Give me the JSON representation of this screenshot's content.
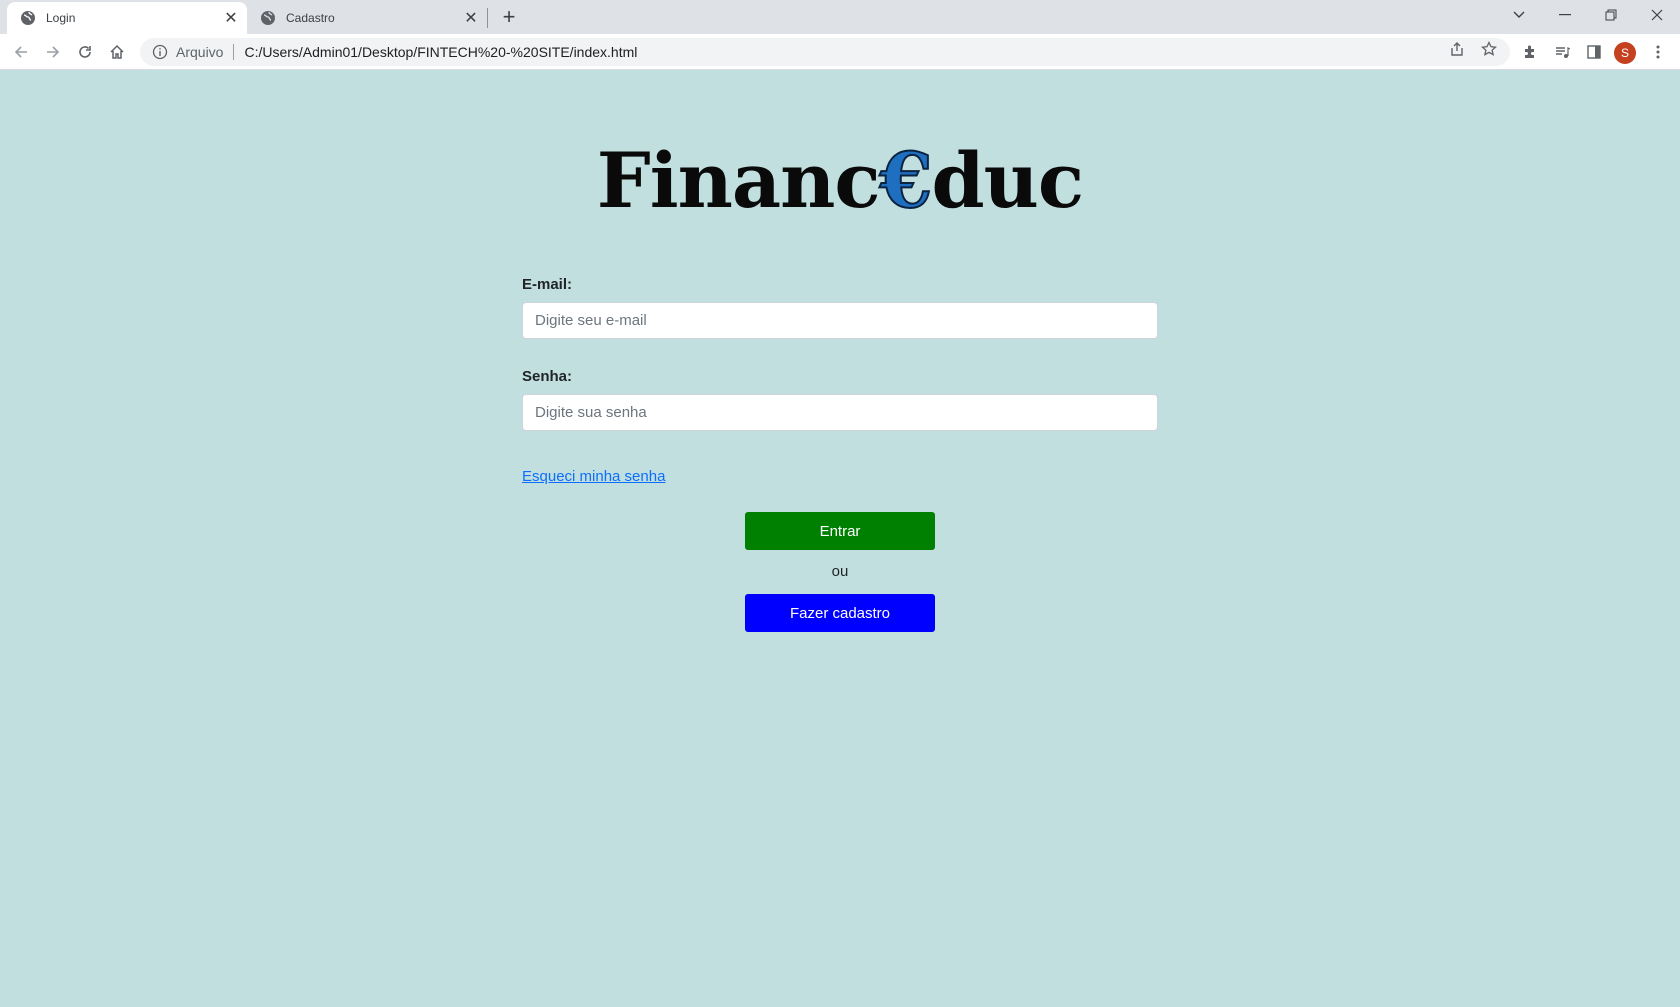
{
  "browser": {
    "tabs": [
      {
        "title": "Login",
        "active": true
      },
      {
        "title": "Cadastro",
        "active": false
      }
    ],
    "address": {
      "scheme_label": "Arquivo",
      "url": "C:/Users/Admin01/Desktop/FINTECH%20-%20SITE/index.html"
    },
    "profile_initial": "S"
  },
  "page": {
    "logo": {
      "part1": "Financ",
      "euro": "€",
      "part2": "duc"
    },
    "email": {
      "label": "E-mail:",
      "placeholder": "Digite seu e-mail",
      "value": ""
    },
    "password": {
      "label": "Senha:",
      "placeholder": "Digite sua senha",
      "value": ""
    },
    "forgot_link": "Esqueci minha senha",
    "enter_button": "Entrar",
    "or_text": "ou",
    "signup_button": "Fazer cadastro"
  },
  "colors": {
    "page_background": "#c1dfdf",
    "enter_button": "#008000",
    "signup_button": "#0000ff",
    "link": "#0d6efd",
    "logo_euro": "#1f6fc0"
  }
}
